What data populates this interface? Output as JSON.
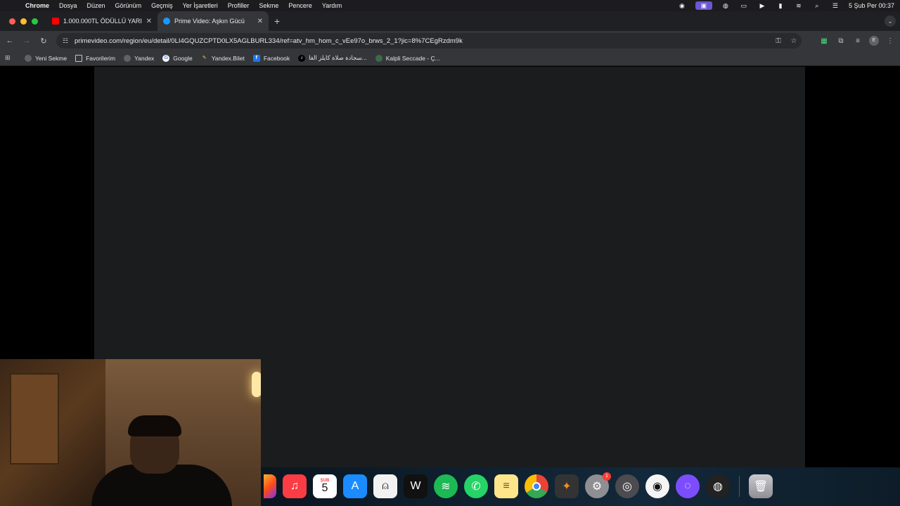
{
  "menubar": {
    "app": "Chrome",
    "items": [
      "Dosya",
      "Düzen",
      "Görünüm",
      "Geçmiş",
      "Yer İşaretleri",
      "Profiller",
      "Sekme",
      "Pencere",
      "Yardım"
    ],
    "datetime": "5 Şub Per  00:37"
  },
  "tabs": [
    {
      "title": "1.000.000TL ÖDÜLLÜ YARIŞ",
      "active": false
    },
    {
      "title": "Prime Video: Aşkın Gücü",
      "active": true
    }
  ],
  "omnibox": {
    "url": "primevideo.com/region/eu/detail/0LI4GQUZCPTD0LX5AGLBURL334/ref=atv_hm_hom_c_vEe97o_brws_2_1?jic=8%7CEgRzdm9k"
  },
  "profile_initial": "E",
  "bookmarks": [
    {
      "label": "Yeni Sekme",
      "icon": "globe-icon"
    },
    {
      "label": "Favorilerim",
      "icon": "folder-icon"
    },
    {
      "label": "Yandex",
      "icon": "globe-icon"
    },
    {
      "label": "Google",
      "icon": "google-icon"
    },
    {
      "label": "Yandex.Bilet",
      "icon": "pencil-icon"
    },
    {
      "label": "Facebook",
      "icon": "facebook-icon"
    },
    {
      "label": "سجادة صلاة كايلز الغا...",
      "icon": "tiktok-icon"
    },
    {
      "label": "Kalpli Seccade - Ç...",
      "icon": "globe-icon"
    }
  ],
  "dock": {
    "calendar_month": "ŞUB",
    "calendar_day": "5",
    "settings_badge": "1"
  },
  "colors": {
    "menubar": "#1c1c1e",
    "tabstrip": "#1f2023",
    "toolbar": "#35363a",
    "panel": "#1a1c1e"
  }
}
